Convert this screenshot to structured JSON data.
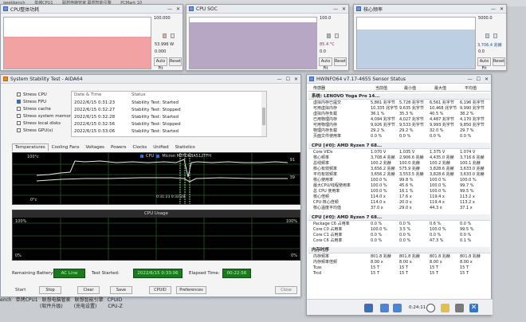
{
  "taskbar_top": {
    "items": [
      "geekbench",
      "单烤CPU1",
      "联想电脑管家 联想智能引擎",
      "PCMark 10"
    ]
  },
  "win_cpu_power": {
    "title": "CPU整体功耗",
    "scale_max": "100.000",
    "current": "53.996 W",
    "scale_min": "0.000",
    "auto_fit": "Auto Fit",
    "reset": "Reset",
    "color": "#f3a2a4"
  },
  "win_cpu_soc": {
    "title": "CPU SOC",
    "scale_max": "100.0",
    "current": "85.4 °C",
    "scale_min": "0.0",
    "auto_fit": "Auto Fit",
    "reset": "Reset",
    "color": "#b7a6c4"
  },
  "win_core_clock": {
    "title": "核心频率",
    "scale_max": "5000.0",
    "current": "3,706.4 兆赫",
    "scale_min": "0.0",
    "auto_fit": "Auto Fit",
    "reset": "Reset",
    "color": "#bccfe3"
  },
  "aida": {
    "title": "System Stability Test - AIDA64",
    "checks": [
      {
        "label": "Stress CPU",
        "on": false
      },
      {
        "label": "Stress FPU",
        "on": true
      },
      {
        "label": "Stress cache",
        "on": false
      },
      {
        "label": "Stress system memory",
        "on": false
      },
      {
        "label": "Stress local disks",
        "on": false
      },
      {
        "label": "Stress GPU(s)",
        "on": false
      }
    ],
    "log_headers": [
      "Date & Time",
      "Status"
    ],
    "log": [
      {
        "time": "2022/6/15 0:31:23",
        "status": "Stability Test: Started"
      },
      {
        "time": "2022/6/15 0:32:27",
        "status": "Stability Test: Stopped"
      },
      {
        "time": "2022/6/15 0:32:28",
        "status": "Stability Test: Started"
      },
      {
        "time": "2022/6/15 0:32:56",
        "status": "Stability Test: Stopped"
      },
      {
        "time": "2022/6/15 0:33:06",
        "status": "Stability Test: Started"
      }
    ],
    "tabs": [
      "Temperatures",
      "Cooling Fans",
      "Voltages",
      "Powers",
      "Clocks",
      "Unified",
      "Statistics"
    ],
    "temp_legend": [
      "CPU",
      "Micron MTFDKBA512TFH"
    ],
    "temp_top": "100°c",
    "temp_bottom": "0°c",
    "temp_right_top": "91",
    "temp_right_mid": "39",
    "temp_time": "0:31:23 0:32:28",
    "usage_title": "CPU Usage",
    "usage_top": "100%",
    "usage_bottom": "0%",
    "usage_right_top": "100%",
    "usage_right_bottom": "0%",
    "remaining_label": "Remaining Battery:",
    "remaining_value": "AC Line",
    "started_label": "Test Started:",
    "started_value": "2022/6/15 0:33:06",
    "elapsed_label": "Elapsed Time:",
    "elapsed_value": "00:22:56",
    "buttons": [
      "Start",
      "Stop",
      "Clear",
      "Save",
      "CPUID",
      "Preferences",
      "Close"
    ]
  },
  "hwinfo": {
    "title": "HWiNFO64 v7.17-4655 Sensor Status",
    "headers": [
      "传感器",
      "当前值",
      "最小值",
      "最大值",
      "平均值"
    ],
    "sections": [
      {
        "name": "系统: LENOVO Yoga Pro 14...",
        "rows": [
          [
            "虚拟内存已提交",
            "5,861 兆字节",
            "5,728 兆字节",
            "6,561 兆字节",
            "6,196 兆字节"
          ],
          [
            "可用虚拟内存",
            "10,335 兆字节",
            "9,635 兆字节",
            "10,468 兆字节",
            "9,990 兆字节"
          ],
          [
            "虚拟内存负载",
            "36.1 %",
            "35.3 %",
            "40.5 %",
            "38.2 %"
          ],
          [
            "已用物理内存",
            "4,094 兆字节",
            "4,027 兆字节",
            "4,487 兆字节",
            "4,170 兆字节"
          ],
          [
            "可用物理内存",
            "9,926 兆字节",
            "9,533 兆字节",
            "9,993 兆字节",
            "9,850 兆字节"
          ],
          [
            "物理内存负载",
            "29.2 %",
            "29.2 %",
            "32.0 %",
            "29.7 %"
          ],
          [
            "页面文件使用率",
            "0.0 %",
            "0.0 %",
            "0.0 %",
            "0.0 %"
          ]
        ]
      },
      {
        "name": "CPU [#0]: AMD Ryzen 7 68...",
        "rows": [
          [
            "Core VIDs",
            "1.070 V",
            "1.035 V",
            "1.375 V",
            "1.074 V"
          ],
          [
            "核心频率",
            "3,708.4 兆赫",
            "2,906.6 兆赫",
            "4,435.0 兆赫",
            "3,716.6 兆赫"
          ],
          [
            "总线频率",
            "100.2 兆赫",
            "100.0 兆赫",
            "100.2 兆赫",
            "100.1 兆赫"
          ],
          [
            "核心有效频率",
            "3,656.2 兆赫",
            "575.9 兆赫",
            "3,828.6 兆赫",
            "3,633.0 兆赫"
          ],
          [
            "平均有效频率",
            "3,656.2 兆赫",
            "3,553.5 兆赫",
            "3,828.6 兆赫",
            "3,633.0 兆赫"
          ],
          [
            "核心使用率",
            "100.0 %",
            "99.8 %",
            "100.0 %",
            "100.0 %"
          ],
          [
            "最大CPU/线程使用率",
            "100.0 %",
            "45.6 %",
            "100.0 %",
            "99.7 %"
          ],
          [
            "总 CPU 使用率",
            "100.0 %",
            "16.1 %",
            "100.0 %",
            "99.5 %"
          ],
          [
            "核心倍频",
            "114.0 x",
            "17.6 x",
            "119.4 x",
            "113.2 x"
          ],
          [
            "CPU 核心倍频",
            "114.0 x",
            "20.0 x",
            "119.4 x",
            "113.2 x"
          ],
          [
            "核心温度平均值",
            "37.0 x",
            "29.0 x",
            "44.3 x",
            "37.1 x"
          ]
        ]
      },
      {
        "name": "CPU [#0]: AMD Ryzen 7 68...",
        "rows": [
          [
            "Package C6 占用率",
            "0.0 %",
            "0.0 %",
            "0.6 %",
            "0.0 %"
          ],
          [
            "Core C0 占用率",
            "100.0 %",
            "3.5 %",
            "100.0 %",
            "99.5 %"
          ],
          [
            "Core C1 占用率",
            "0.0 %",
            "0.0 %",
            "0.0 %",
            "0.0 %"
          ],
          [
            "Core C6 占用率",
            "0.0 %",
            "0.0 %",
            "47.3 %",
            "0.1 %"
          ]
        ]
      },
      {
        "name": "内存时序",
        "rows": [
          [
            "内存频率",
            "801.8 兆赫",
            "801.8 兆赫",
            "801.8 兆赫",
            "801.8 兆赫"
          ],
          [
            "内存频率倍频",
            "8.00 x",
            "8.00 x",
            "8.00 x",
            "8.00 x"
          ],
          [
            "Tcas",
            "15 T",
            "15 T",
            "15 T",
            "15 T"
          ],
          [
            "Trcd",
            "15 T",
            "15 T",
            "15 T",
            "15 T"
          ]
        ]
      }
    ],
    "timer": "0:24:11"
  },
  "bottom_left": {
    "line1": [
      "ench",
      "单烤CPU1",
      "联想电脑管家",
      "联想智能引擎",
      "CPUID"
    ],
    "line2": [
      "(软件升级)",
      "(充电设置)",
      "CPU-Z"
    ]
  }
}
